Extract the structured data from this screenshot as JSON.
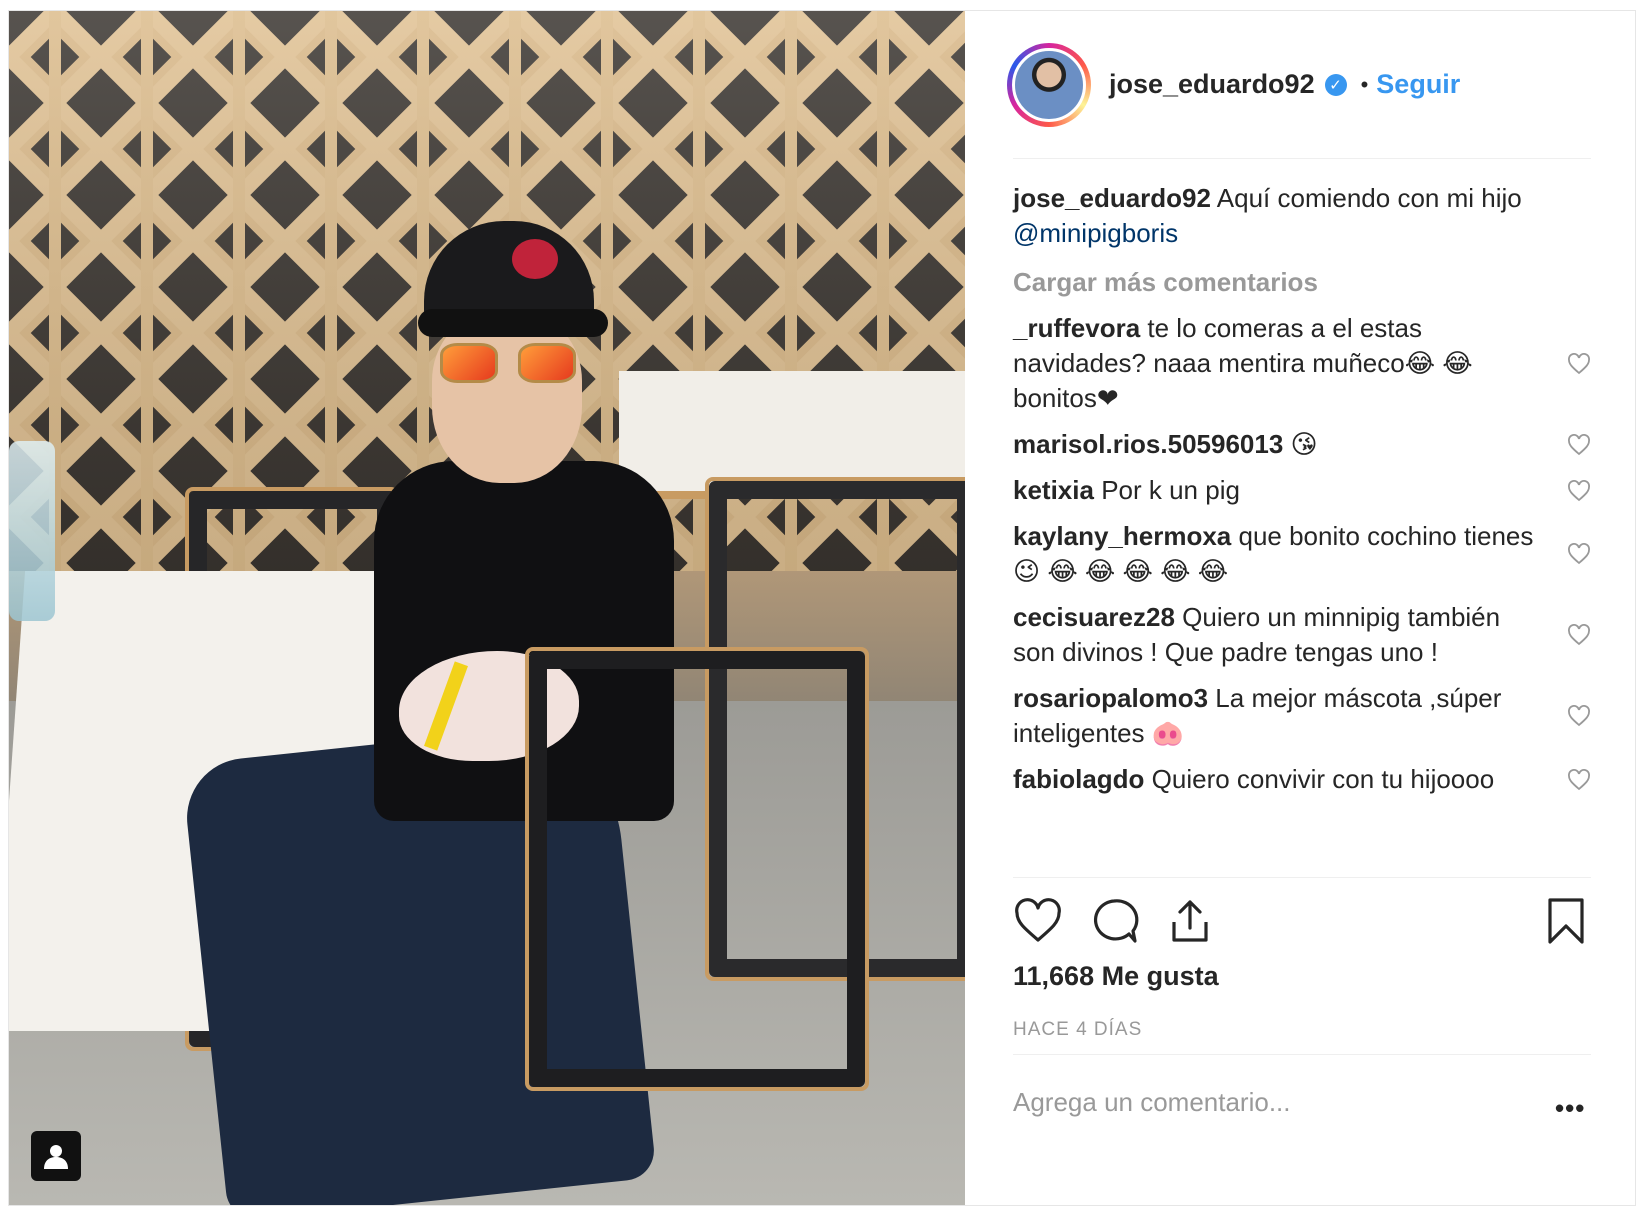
{
  "header": {
    "username": "jose_eduardo92",
    "verified_icon": "verified-badge-icon",
    "separator": "•",
    "follow_label": "Seguir"
  },
  "caption": {
    "username": "jose_eduardo92",
    "text": "Aquí comiendo con mi hijo",
    "mention": "@minipigboris"
  },
  "load_more": "Cargar más comentarios",
  "comments": [
    {
      "user": "_ruffevora",
      "text": "te lo comeras a el estas navidades? naaa mentira muñeco😂 😂 bonitos❤"
    },
    {
      "user": "marisol.rios.50596013",
      "text": "😘"
    },
    {
      "user": "ketixia",
      "text": "Por k un pig"
    },
    {
      "user": "kaylany_hermoxa",
      "text": "que bonito cochino tienes😉 😂 😂 😂 😂 😂"
    },
    {
      "user": "cecisuarez28",
      "text": "Quiero un minnipig también son divinos ! Que padre tengas uno !"
    },
    {
      "user": "rosariopalomo3",
      "text": "La mejor máscota ,súper inteligentes 🐽"
    },
    {
      "user": "fabiolagdo",
      "text": "Quiero convivir con tu hijoooo"
    }
  ],
  "actions": {
    "like_icon": "heart-icon",
    "comment_icon": "comment-bubble-icon",
    "share_icon": "share-upload-icon",
    "save_icon": "bookmark-icon"
  },
  "likes_text": "11,668 Me gusta",
  "timestamp": "HACE 4 DÍAS",
  "add_comment_placeholder": "Agrega un comentario...",
  "more_options": "•••",
  "colors": {
    "link_blue": "#3897f0",
    "mention_blue": "#003569",
    "text": "#262626",
    "muted": "#999999"
  }
}
